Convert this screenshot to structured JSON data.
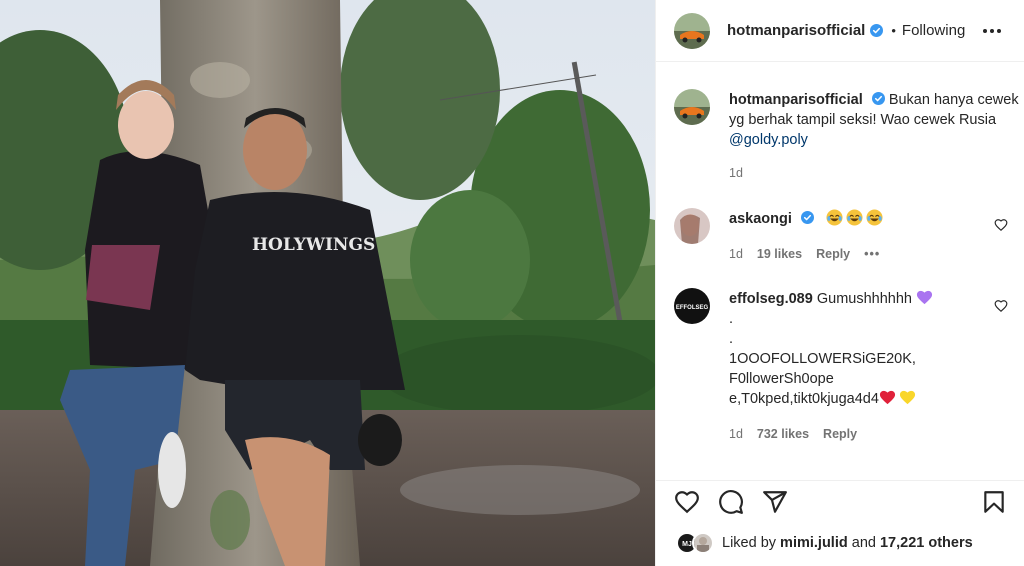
{
  "post": {
    "author": "hotmanparisofficial",
    "follow_state": "Following",
    "separator": "•",
    "caption_text": "Bukan hanya cewek yg berhak tampil seksi! Wao cewek Rusia ",
    "caption_mention": "@goldy.poly",
    "caption_time": "1d",
    "shirt_print": "HOLYWINGS"
  },
  "comments": [
    {
      "username": "askaongi",
      "verified": true,
      "text_emoji": [
        "grinning-tears-emoji",
        "grinning-tears-emoji",
        "grinning-tears-emoji"
      ],
      "time": "1d",
      "likes": "19 likes",
      "reply": "Reply",
      "more": "•••"
    },
    {
      "username": "effolseg.089",
      "text_line1": "Gumushhhhhh",
      "text_line2": ".",
      "text_line3": ".",
      "text_line4": "1OOOFOLLOWERSiGE20K,",
      "text_line5": "F0llowerSh0ope",
      "text_line6": "e,T0kped,tikt0kjuga4d4",
      "avatar_text": "EFFOLSEG",
      "time": "1d",
      "likes": "732 likes",
      "reply": "Reply"
    }
  ],
  "likes_summary": {
    "prefix": "Liked by",
    "user": "mimi.julid",
    "middle": "and",
    "others": "17,221 others",
    "avatar1_initials": "MJ"
  },
  "icons": [
    "heart-icon",
    "comment-icon",
    "share-icon",
    "bookmark-icon",
    "verified-badge-icon",
    "more-icon"
  ],
  "colors": {
    "verified": "#3897f0",
    "mention": "#00376b",
    "muted": "#737373",
    "text": "#262626"
  }
}
